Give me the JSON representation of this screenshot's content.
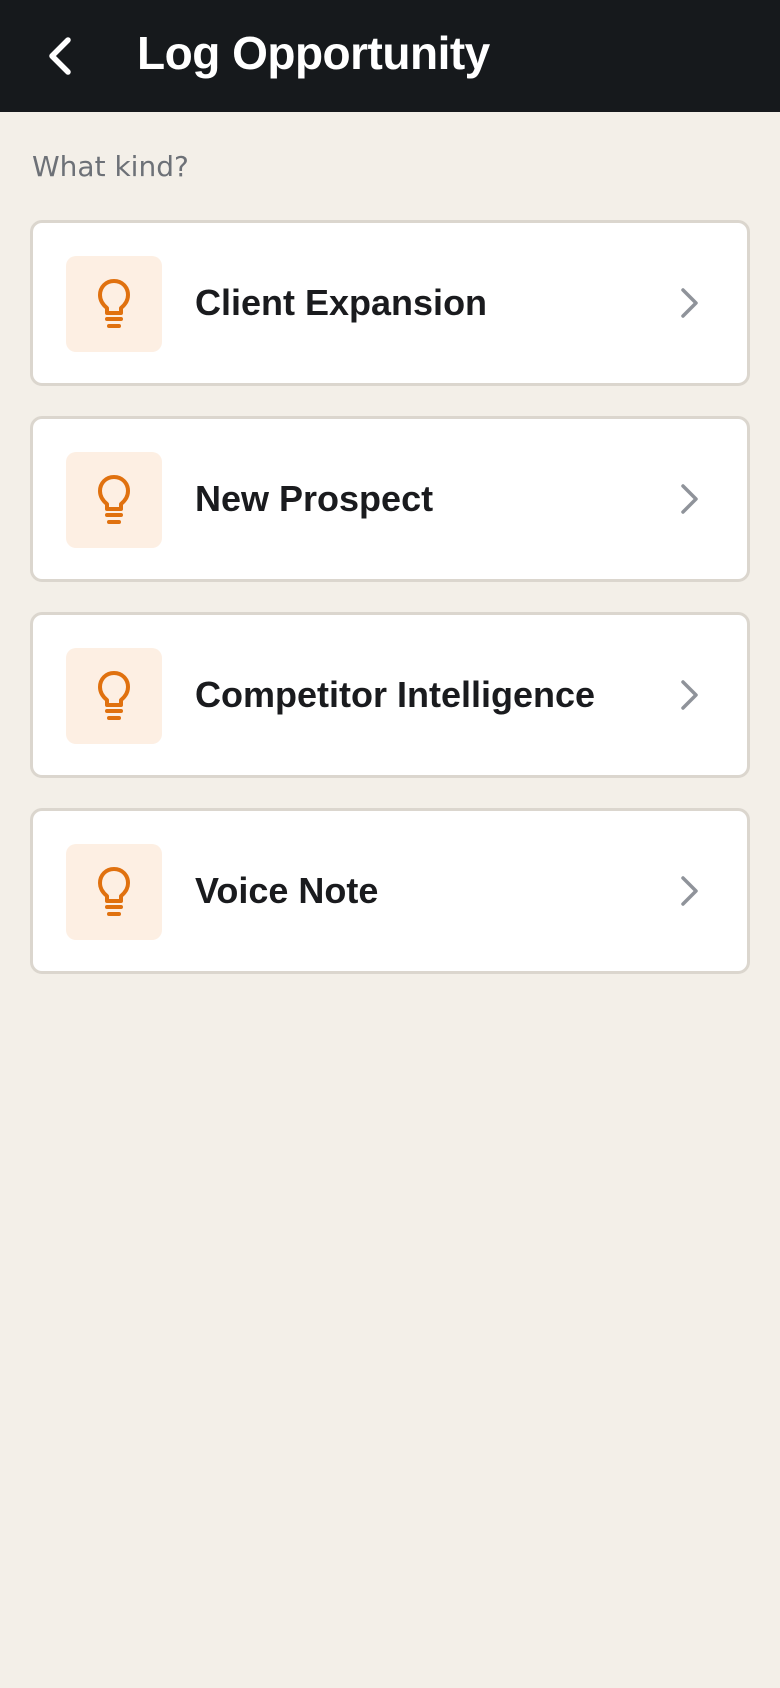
{
  "header": {
    "title": "Log Opportunity",
    "back_icon": "chevron-left-icon",
    "background": "#16191c"
  },
  "prompt": "What kind?",
  "options": [
    {
      "label": "Client Expansion",
      "icon": "lightbulb-icon"
    },
    {
      "label": "New Prospect",
      "icon": "lightbulb-icon"
    },
    {
      "label": "Competitor Intelligence",
      "icon": "lightbulb-icon"
    },
    {
      "label": "Voice Note",
      "icon": "lightbulb-icon"
    }
  ],
  "colors": {
    "accent": "#e0710f",
    "icon_tile": "#fdefe3",
    "page_background": "#f3efe8",
    "chevron": "#8f939a"
  }
}
